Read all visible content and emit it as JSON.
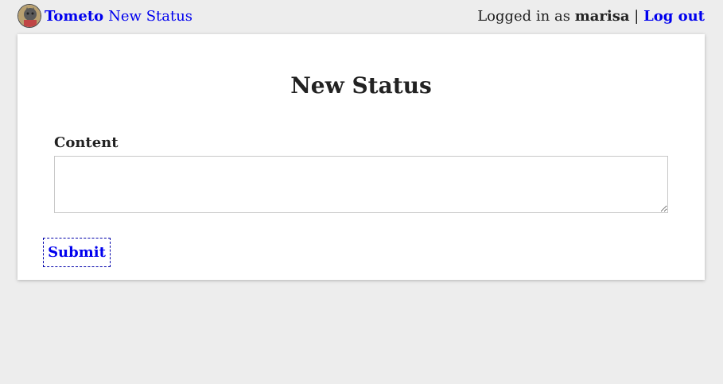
{
  "header": {
    "brand_name": "Tometo",
    "page_name": "New Status",
    "logged_in_prefix": "Logged in as",
    "username": "marisa",
    "separator": "|",
    "logout_label": "Log out"
  },
  "form": {
    "heading": "New Status",
    "content_label": "Content",
    "content_value": "",
    "submit_label": "Submit"
  },
  "icons": {
    "avatar": "avatar-image"
  },
  "colors": {
    "link": "#0000ee",
    "background": "#ededed",
    "card": "#ffffff"
  }
}
